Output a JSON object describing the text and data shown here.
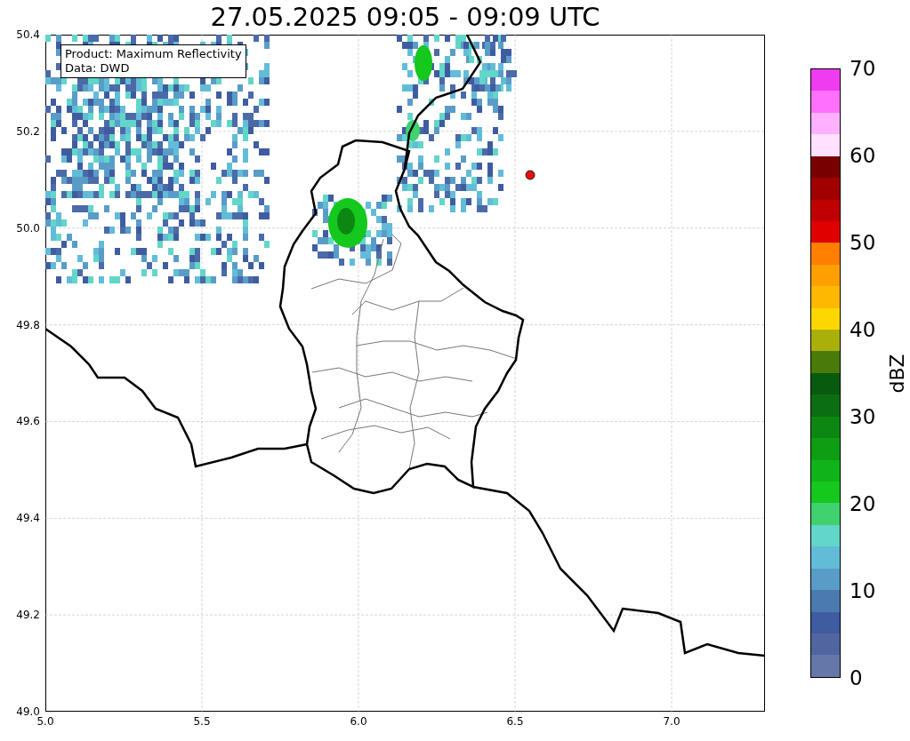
{
  "title": "27.05.2025 09:05 - 09:09 UTC",
  "annotation": [
    "Product: Maximum Reflectivity",
    "Data: DWD"
  ],
  "y_ticks": [
    "50.4",
    "50.2",
    "50.0",
    "49.8",
    "49.6",
    "49.4",
    "49.2",
    "49.0"
  ],
  "x_ticks": [
    "5.0",
    "5.5",
    "6.0",
    "6.5",
    "7.0"
  ],
  "colorbar": {
    "label": "dBZ",
    "ticks": [
      "70",
      "60",
      "50",
      "40",
      "30",
      "20",
      "10",
      "0"
    ],
    "segments": [
      {
        "color": "#f03cf0"
      },
      {
        "color": "#ff70ff"
      },
      {
        "color": "#ffb0ff"
      },
      {
        "color": "#ffe0ff"
      },
      {
        "color": "#780000"
      },
      {
        "color": "#a00000"
      },
      {
        "color": "#c00000"
      },
      {
        "color": "#e00000"
      },
      {
        "color": "#ff7f00"
      },
      {
        "color": "#ff9f00"
      },
      {
        "color": "#ffb800"
      },
      {
        "color": "#ffd700"
      },
      {
        "color": "#aab00a"
      },
      {
        "color": "#4a7a0a"
      },
      {
        "color": "#085a0e"
      },
      {
        "color": "#0c6e12"
      },
      {
        "color": "#0c8812"
      },
      {
        "color": "#0e9e14"
      },
      {
        "color": "#10b41a"
      },
      {
        "color": "#14c81e"
      },
      {
        "color": "#3fd26e"
      },
      {
        "color": "#62d6c8"
      },
      {
        "color": "#62bcd8"
      },
      {
        "color": "#5a9cc8"
      },
      {
        "color": "#4b7ab0"
      },
      {
        "color": "#3f5ca0"
      },
      {
        "color": "#5166a0"
      },
      {
        "color": "#6477a8"
      }
    ]
  }
}
